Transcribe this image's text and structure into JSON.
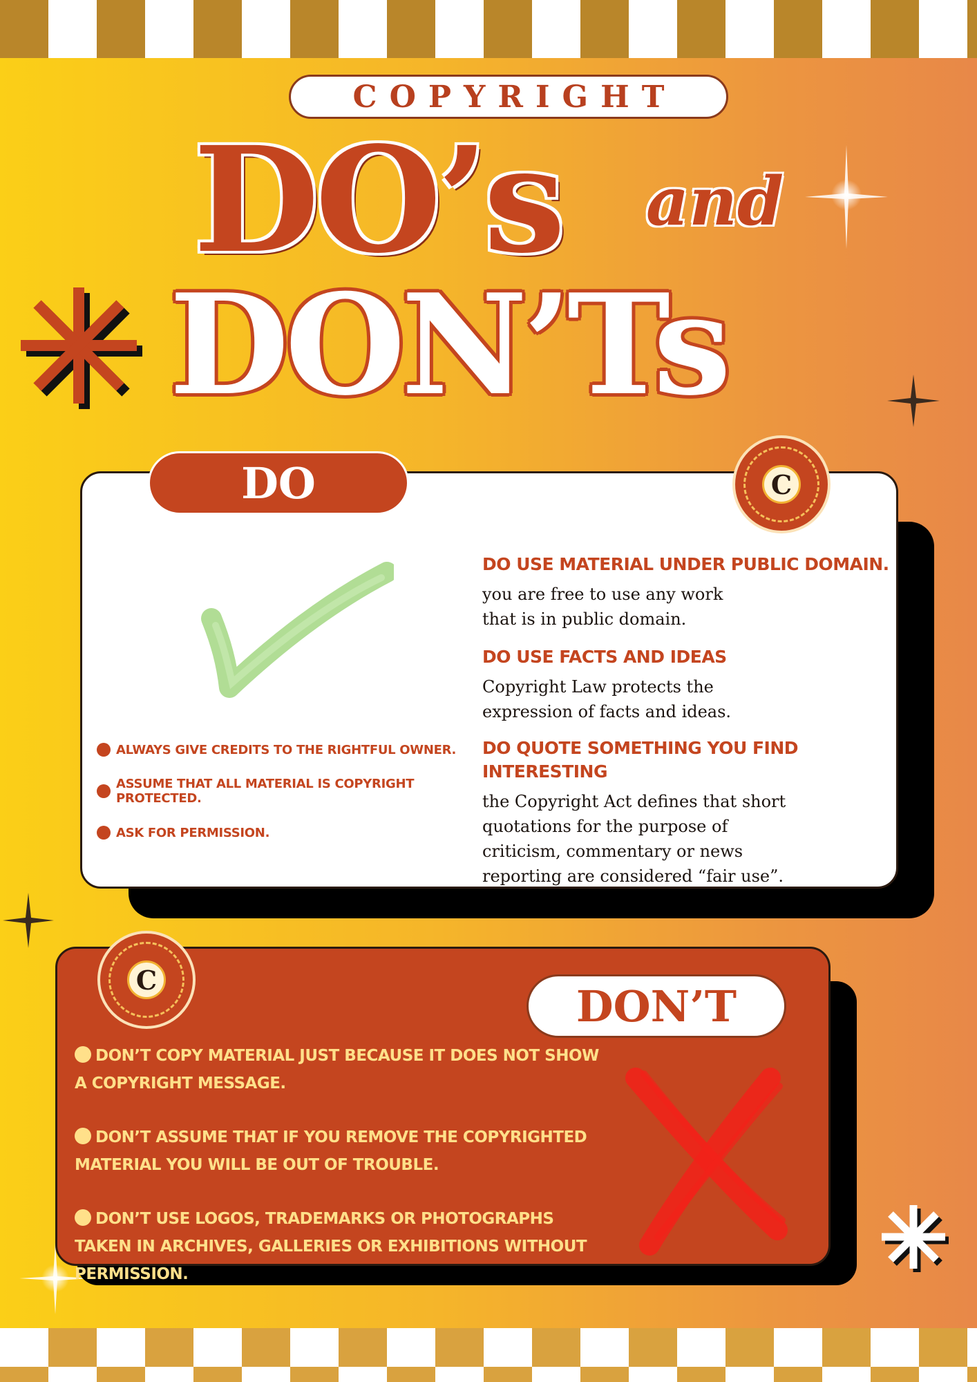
{
  "header": {
    "kicker": "COPYRIGHT",
    "title_line1": "DO’s",
    "connector": "and",
    "title_line2": "DON’Ts"
  },
  "do_section": {
    "label": "DO",
    "badge_letter": "C",
    "bullets": [
      "ALWAYS GIVE CREDITS TO THE RIGHTFUL OWNER.",
      "ASSUME THAT ALL MATERIAL IS COPYRIGHT PROTECTED.",
      "ASK FOR PERMISSION."
    ],
    "items": [
      {
        "heading": "DO USE MATERIAL UNDER PUBLIC DOMAIN.",
        "body_lines": [
          "you are free to use any work",
          "that is in public domain."
        ]
      },
      {
        "heading": "DO USE FACTS AND IDEAS",
        "body_lines": [
          "Copyright Law protects the",
          "expression of facts and ideas."
        ]
      },
      {
        "heading": "DO QUOTE SOMETHING YOU FIND INTERESTING",
        "body_lines": [
          "the Copyright Act defines that short",
          "quotations for the purpose of",
          "criticism, commentary or news",
          "reporting are considered “fair use”."
        ]
      }
    ]
  },
  "dont_section": {
    "label": "DON’T",
    "badge_letter": "C",
    "bullets": [
      "DON’T COPY MATERIAL JUST BECAUSE IT DOES NOT SHOW A COPYRIGHT MESSAGE.",
      "DON’T ASSUME THAT IF YOU REMOVE THE COPYRIGHTED MATERIAL YOU WILL BE OUT OF TROUBLE.",
      "DON’T USE LOGOS, TRADEMARKS OR PHOTOGRAPHS TAKEN IN ARCHIVES, GALLERIES OR EXHIBITIONS WITHOUT PERMISSION."
    ]
  },
  "colors": {
    "accent": "#c4451f",
    "background_left": "#fbcf17",
    "background_right": "#e88848",
    "checker": "#b9862a",
    "dont_text": "#ffe08a"
  },
  "icons": [
    "asterisk-icon",
    "sparkle-icon",
    "checkmark-icon",
    "x-mark-icon",
    "copyright-badge-icon"
  ]
}
